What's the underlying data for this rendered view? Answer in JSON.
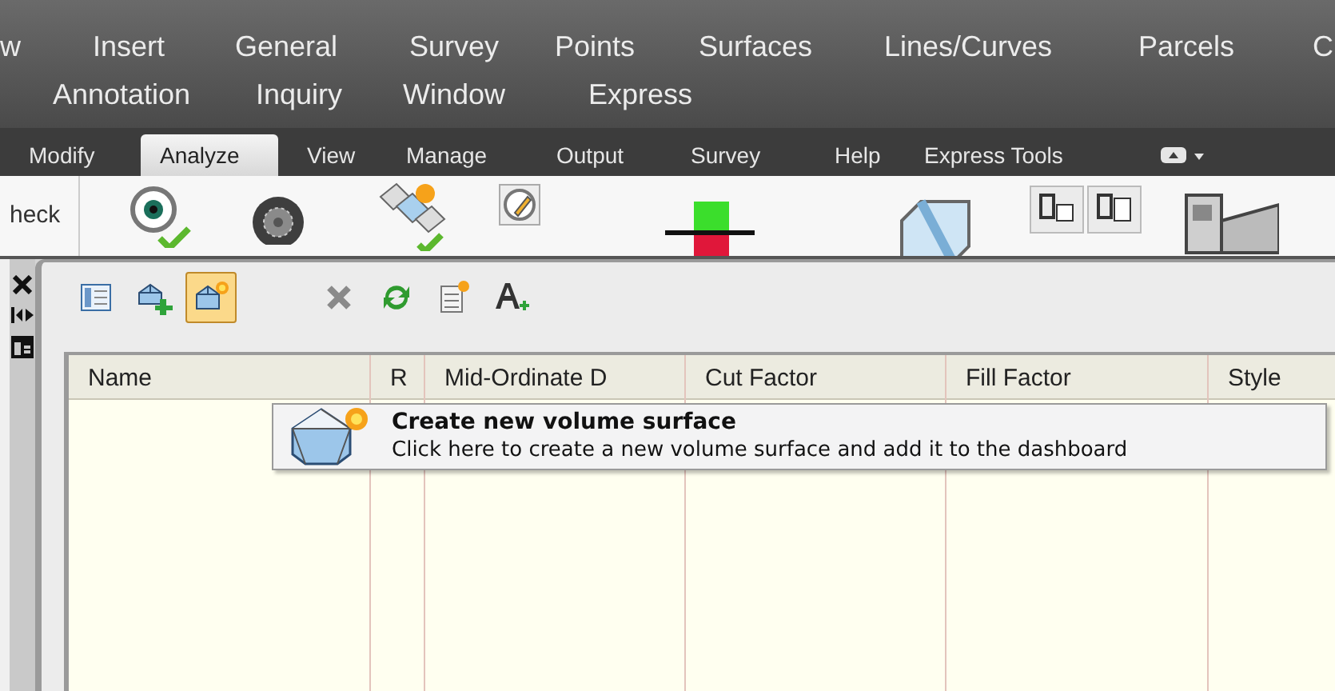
{
  "menu_bar": {
    "items": [
      "w",
      "Insert",
      "General",
      "Survey",
      "Points",
      "Surfaces",
      "Lines/Curves",
      "Parcels",
      "C",
      "Annotation",
      "Inquiry",
      "Window",
      "Express"
    ]
  },
  "ribbon_tabs": [
    {
      "label": "Modify",
      "selected": false
    },
    {
      "label": "Analyze",
      "selected": true
    },
    {
      "label": "View",
      "selected": false
    },
    {
      "label": "Manage",
      "selected": false
    },
    {
      "label": "Output",
      "selected": false
    },
    {
      "label": "Survey",
      "selected": false
    },
    {
      "label": "Help",
      "selected": false
    },
    {
      "label": "Express Tools",
      "selected": false
    }
  ],
  "ribbon_panel": {
    "label": "heck"
  },
  "toolbar": {
    "buttons": [
      {
        "kind": "columns",
        "selected": false
      },
      {
        "kind": "add-surface",
        "selected": false
      },
      {
        "kind": "new-volume",
        "selected": true
      },
      {
        "kind": "delete",
        "selected": false
      },
      {
        "kind": "refresh",
        "selected": false
      },
      {
        "kind": "report",
        "selected": false
      },
      {
        "kind": "label",
        "selected": false
      }
    ]
  },
  "table": {
    "columns": [
      "Name",
      "R",
      "Mid-Ordinate D",
      "Cut Factor",
      "Fill Factor",
      "Style"
    ]
  },
  "tooltip": {
    "title": "Create new volume surface",
    "text": "Click here to create a new volume surface and add it to the dashboard"
  }
}
